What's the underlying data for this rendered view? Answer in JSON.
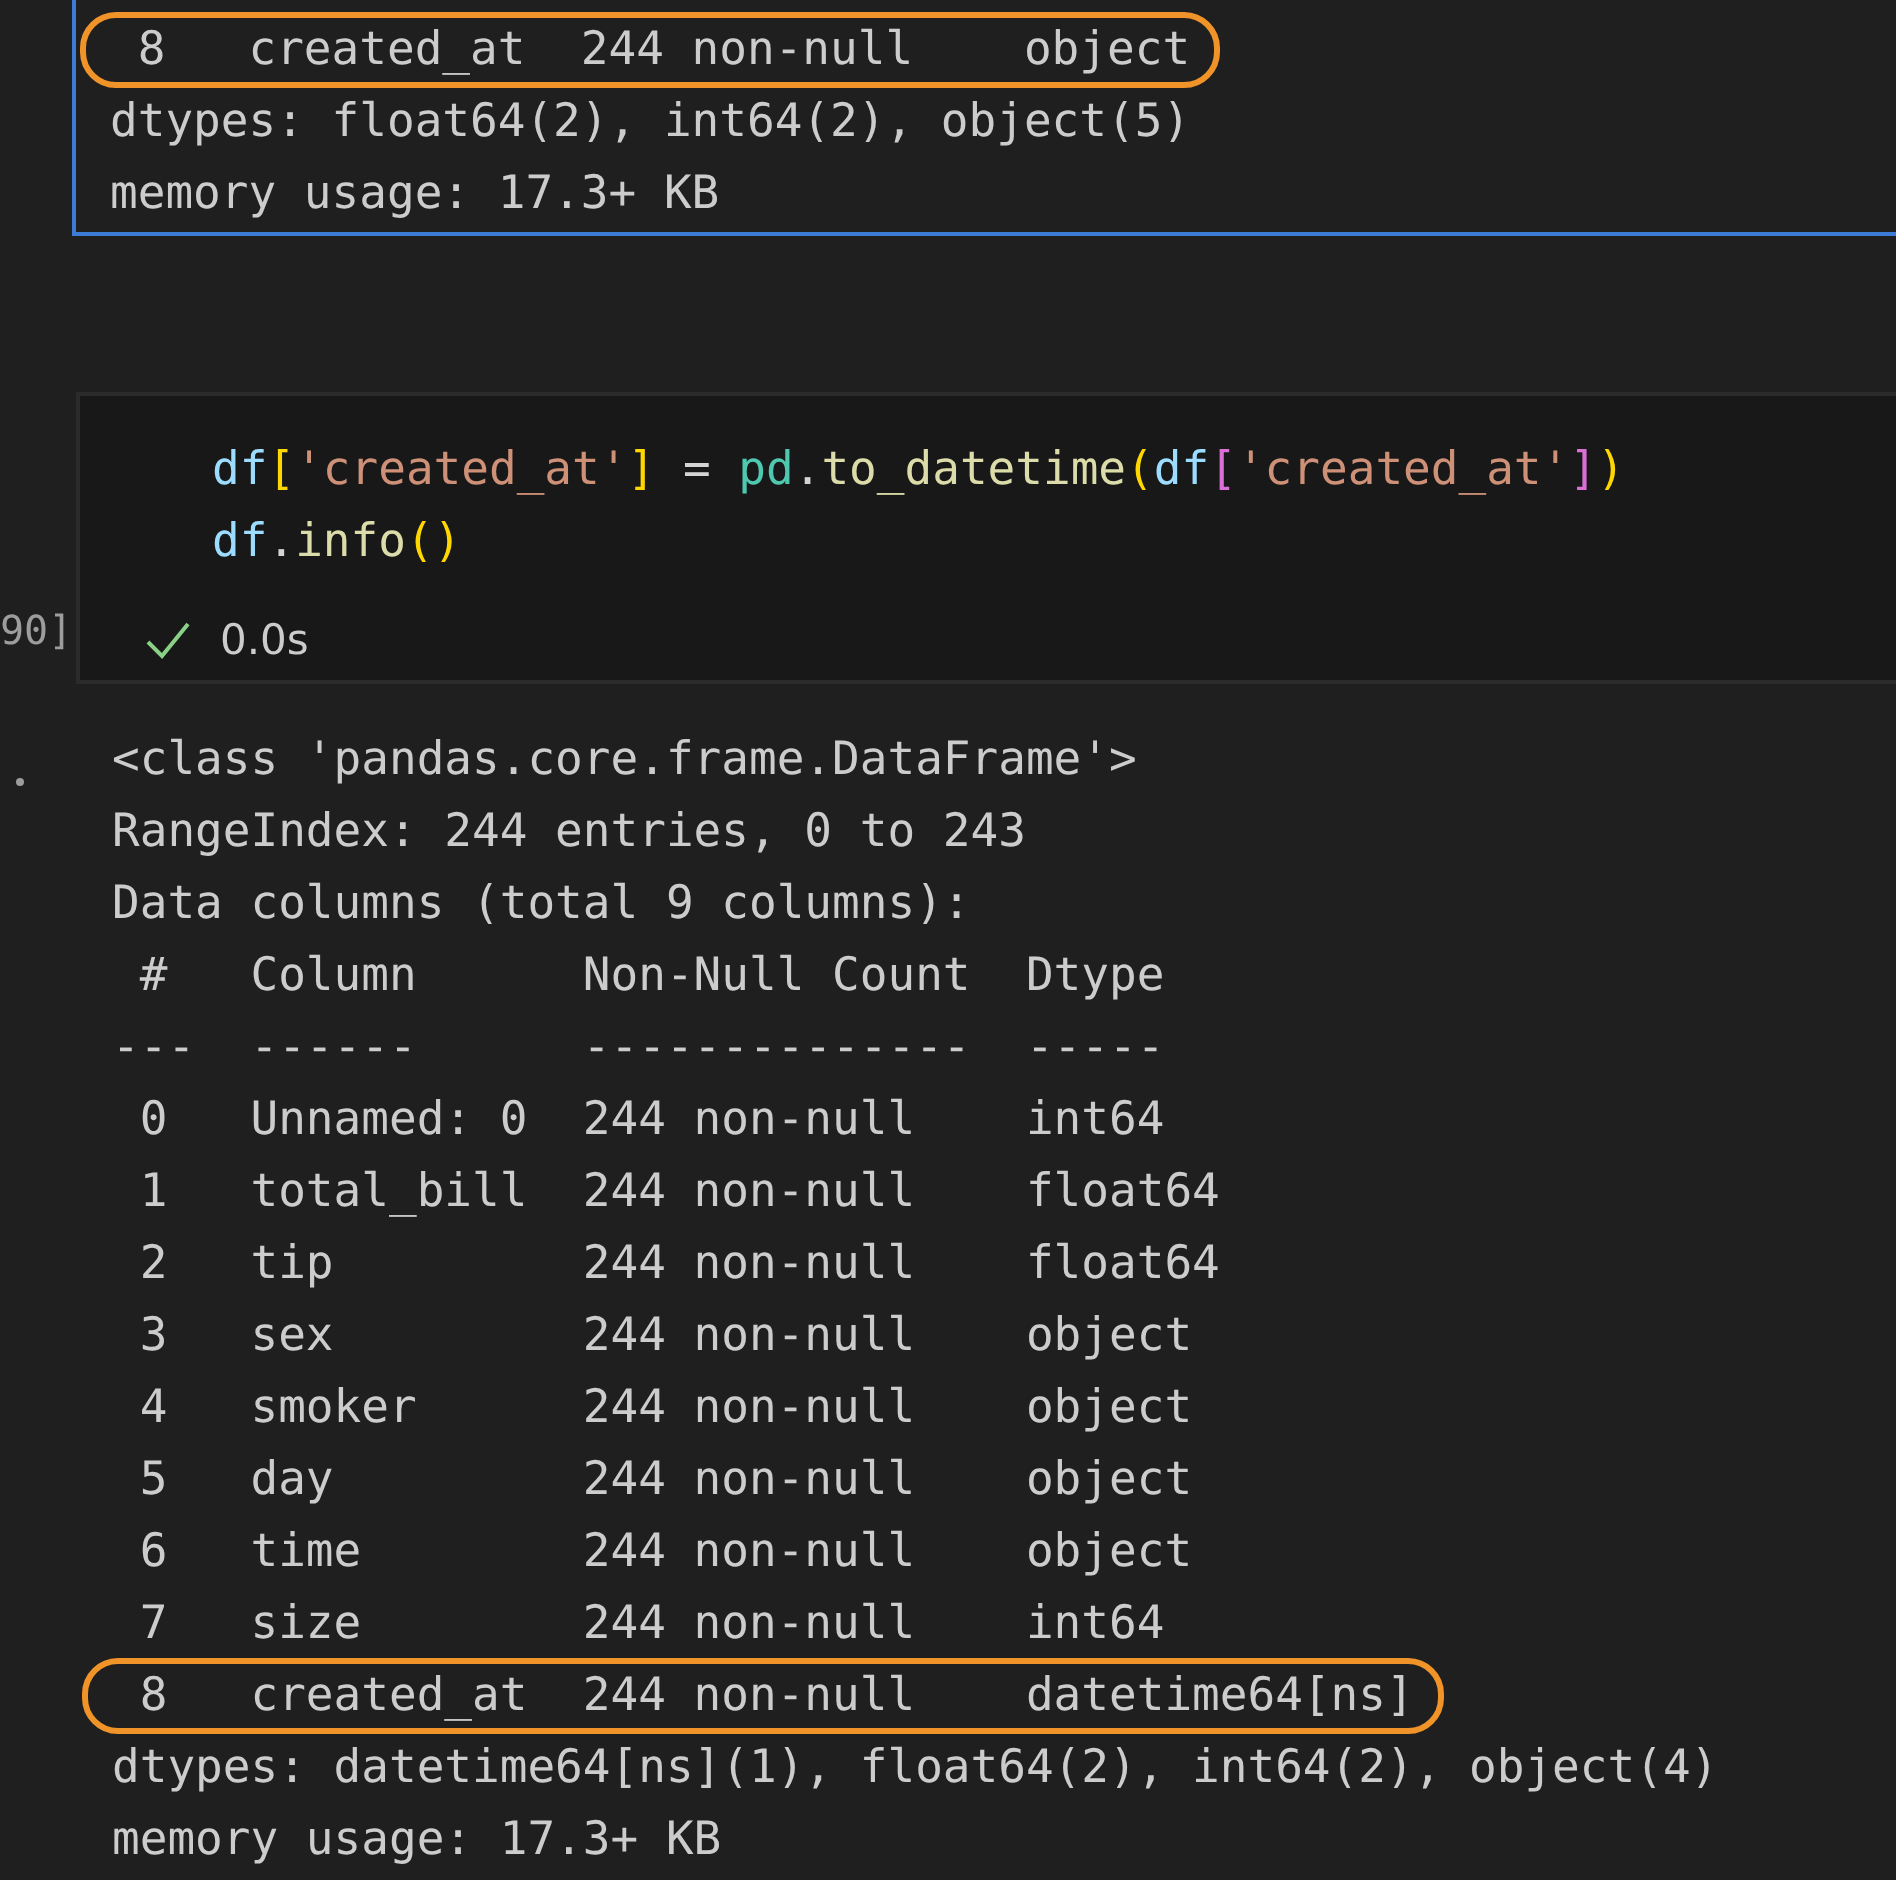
{
  "previous_cell": {
    "output_lines": [
      {
        "text": " 8   created_at  244 non-null    object",
        "highlighted": true
      },
      {
        "text": "dtypes: float64(2), int64(2), object(5)",
        "highlighted": false
      },
      {
        "text": "memory usage: 17.3+ KB",
        "highlighted": false
      }
    ]
  },
  "code_cell": {
    "execution_count": "90]",
    "succeeded": true,
    "duration": "0.0s",
    "code_lines": [
      [
        {
          "text": "df",
          "kind": "variable"
        },
        {
          "text": "[",
          "kind": "bracket1"
        },
        {
          "text": "'created_at'",
          "kind": "string"
        },
        {
          "text": "]",
          "kind": "bracket1"
        },
        {
          "text": " = ",
          "kind": "operator"
        },
        {
          "text": "pd",
          "kind": "module"
        },
        {
          "text": ".to_datetime",
          "kind": "member"
        },
        {
          "text": "(",
          "kind": "bracket1"
        },
        {
          "text": "df",
          "kind": "variable"
        },
        {
          "text": "[",
          "kind": "bracket2"
        },
        {
          "text": "'created_at'",
          "kind": "string"
        },
        {
          "text": "]",
          "kind": "bracket2"
        },
        {
          "text": ")",
          "kind": "bracket1"
        }
      ],
      [
        {
          "text": "df",
          "kind": "variable"
        },
        {
          "text": ".info",
          "kind": "member"
        },
        {
          "text": "()",
          "kind": "bracket1"
        }
      ]
    ],
    "output_lines": [
      {
        "text": "<class 'pandas.core.frame.DataFrame'>",
        "highlighted": false
      },
      {
        "text": "RangeIndex: 244 entries, 0 to 243",
        "highlighted": false
      },
      {
        "text": "Data columns (total 9 columns):",
        "highlighted": false
      },
      {
        "text": " #   Column      Non-Null Count  Dtype",
        "highlighted": false
      },
      {
        "text": "---  ------      --------------  -----",
        "highlighted": false
      },
      {
        "text": " 0   Unnamed: 0  244 non-null    int64",
        "highlighted": false
      },
      {
        "text": " 1   total_bill  244 non-null    float64",
        "highlighted": false
      },
      {
        "text": " 2   tip         244 non-null    float64",
        "highlighted": false
      },
      {
        "text": " 3   sex         244 non-null    object",
        "highlighted": false
      },
      {
        "text": " 4   smoker      244 non-null    object",
        "highlighted": false
      },
      {
        "text": " 5   day         244 non-null    object",
        "highlighted": false
      },
      {
        "text": " 6   time        244 non-null    object",
        "highlighted": false
      },
      {
        "text": " 7   size        244 non-null    int64",
        "highlighted": false
      },
      {
        "text": " 8   created_at  244 non-null    datetime64[ns]",
        "highlighted": true
      },
      {
        "text": "dtypes: datetime64[ns](1), float64(2), int64(2), object(4)",
        "highlighted": false
      },
      {
        "text": "memory usage: 17.3+ KB",
        "highlighted": false
      }
    ]
  }
}
